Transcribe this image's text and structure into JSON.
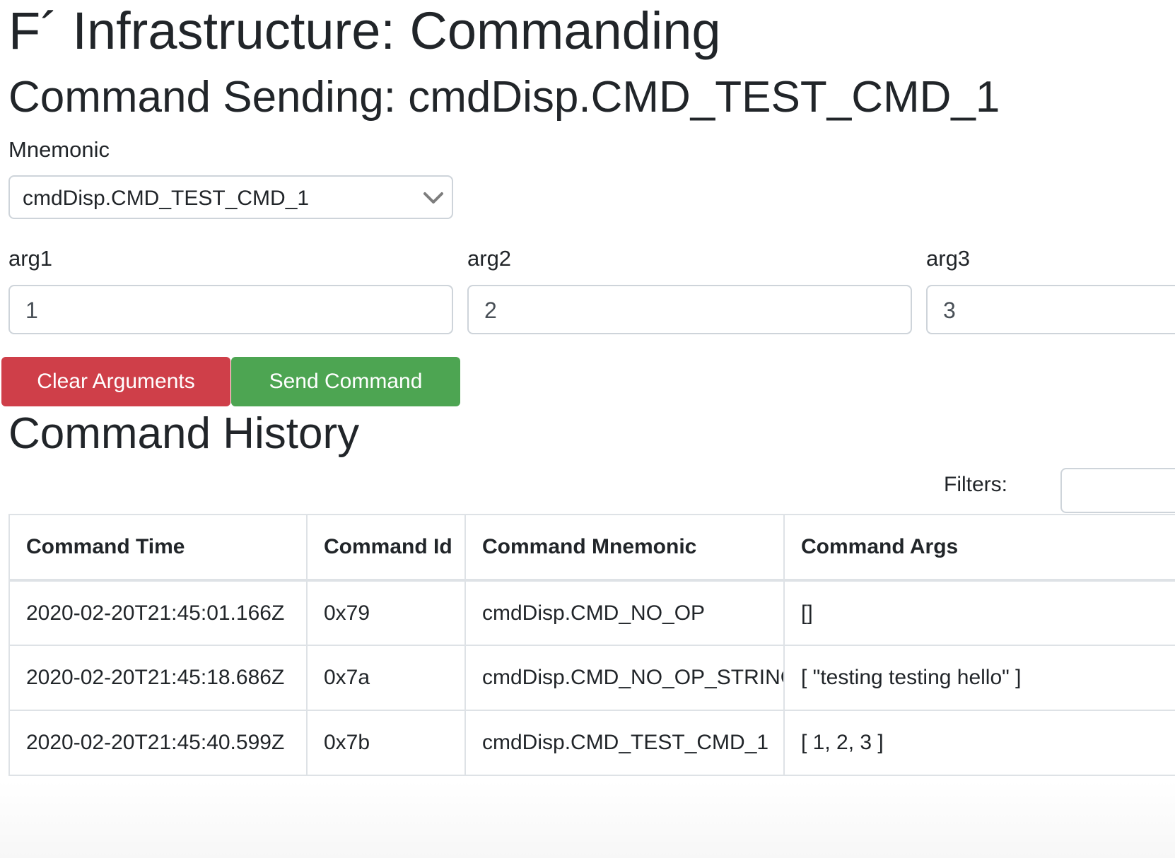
{
  "page": {
    "title": "F´ Infrastructure: Commanding",
    "command_sending_heading": "Command Sending: cmdDisp.CMD_TEST_CMD_1"
  },
  "form": {
    "mnemonic_label": "Mnemonic",
    "mnemonic_value": "cmdDisp.CMD_TEST_CMD_1",
    "args": [
      {
        "label": "arg1",
        "value": "1"
      },
      {
        "label": "arg2",
        "value": "2"
      },
      {
        "label": "arg3",
        "value": "3"
      }
    ],
    "clear_label": "Clear Arguments",
    "send_label": "Send Command",
    "clear_color": "#cf3f49",
    "send_color": "#4da552"
  },
  "history": {
    "heading": "Command History",
    "filters_label": "Filters:",
    "filters_value": "",
    "columns": [
      "Command Time",
      "Command Id",
      "Command Mnemonic",
      "Command Args"
    ],
    "rows": [
      [
        "2020-02-20T21:45:01.166Z",
        "0x79",
        "cmdDisp.CMD_NO_OP",
        "[]"
      ],
      [
        "2020-02-20T21:45:18.686Z",
        "0x7a",
        "cmdDisp.CMD_NO_OP_STRING",
        "[ \"testing testing hello\" ]"
      ],
      [
        "2020-02-20T21:45:40.599Z",
        "0x7b",
        "cmdDisp.CMD_TEST_CMD_1",
        "[ 1, 2, 3 ]"
      ]
    ]
  }
}
